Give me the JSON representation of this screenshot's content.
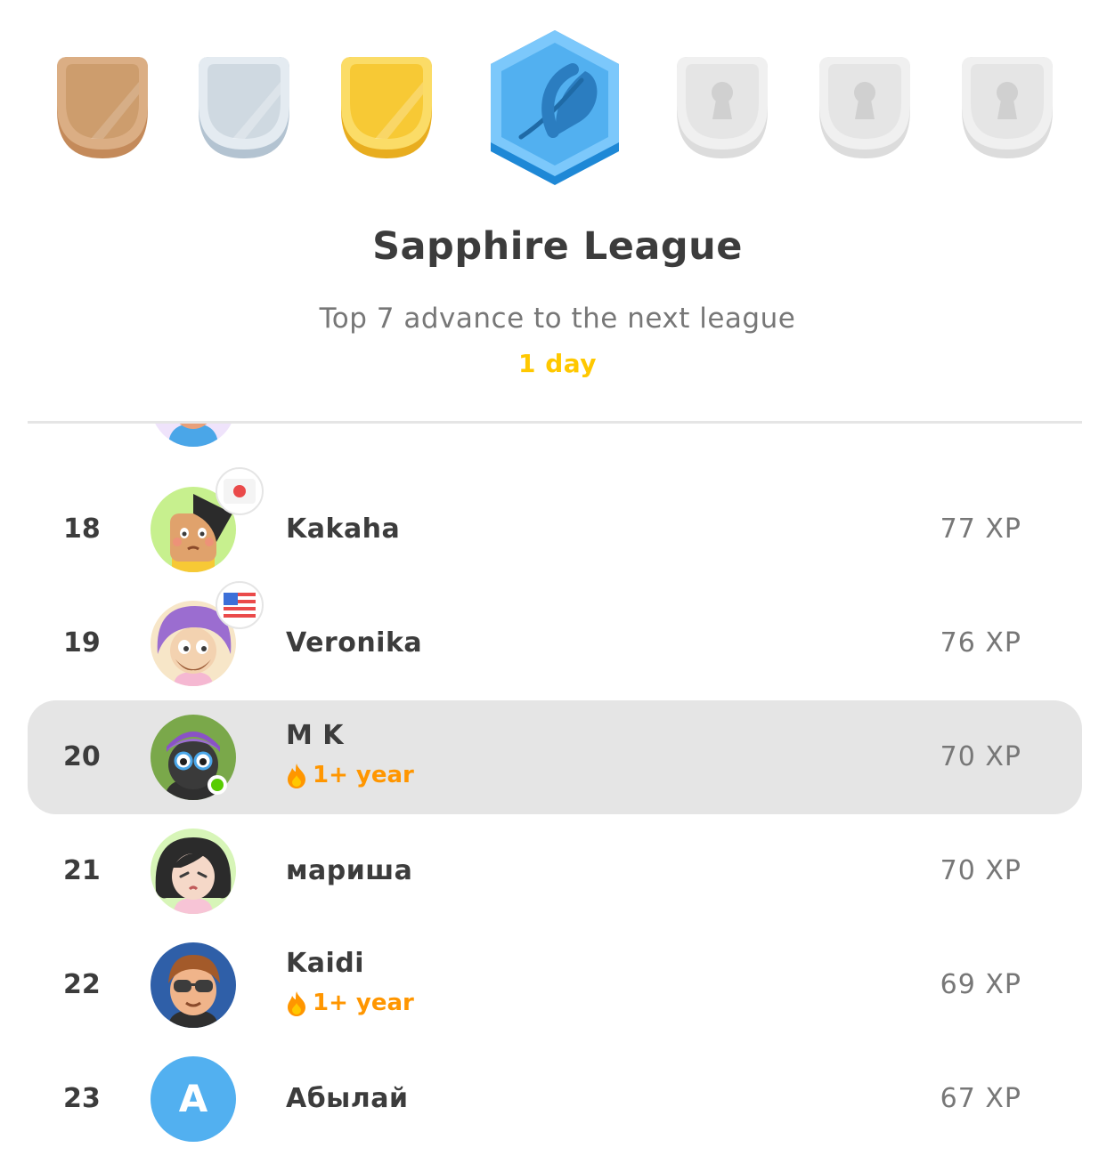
{
  "leagues": [
    {
      "icon": "bronze-shield-icon",
      "color": "#cd9d6d",
      "state": "completed"
    },
    {
      "icon": "silver-shield-icon",
      "color": "#cfd9e1",
      "state": "completed"
    },
    {
      "icon": "gold-shield-icon",
      "color": "#f7c935",
      "state": "completed"
    },
    {
      "icon": "sapphire-feather-icon",
      "color": "#52b0f0",
      "state": "current"
    },
    {
      "icon": "locked-shield-icon",
      "color": "#e5e5e5",
      "state": "locked"
    },
    {
      "icon": "locked-shield-icon",
      "color": "#e5e5e5",
      "state": "locked"
    },
    {
      "icon": "locked-shield-icon",
      "color": "#e5e5e5",
      "state": "locked"
    }
  ],
  "header": {
    "title": "Sapphire League",
    "subtitle": "Top 7 advance to the next league",
    "countdown": "1 day"
  },
  "leaderboard": {
    "rows": [
      {
        "rank": "18",
        "name": "Kakaha",
        "xp": "77 XP",
        "streak": "",
        "flag": "japan-flag-icon",
        "avatar": "avatar-bald-icon"
      },
      {
        "rank": "19",
        "name": "Veronika",
        "xp": "76 XP",
        "streak": "",
        "flag": "usa-flag-icon",
        "avatar": "avatar-purple-hair-icon"
      },
      {
        "rank": "20",
        "name": "M K",
        "xp": "70 XP",
        "streak": "1+ year",
        "online": true,
        "current_user": true,
        "avatar": "avatar-glasses-icon"
      },
      {
        "rank": "21",
        "name": "мариша",
        "xp": "70 XP",
        "streak": "",
        "avatar": "avatar-black-hair-icon"
      },
      {
        "rank": "22",
        "name": "Kaidi",
        "xp": "69 XP",
        "streak": "1+ year",
        "avatar": "avatar-sunglasses-icon"
      },
      {
        "rank": "23",
        "name": "Абылай",
        "xp": "67 XP",
        "streak": "",
        "avatar_letter": "A"
      }
    ]
  },
  "colors": {
    "accent": "#ffc800",
    "streak": "#ff9600",
    "online": "#58cc02",
    "sapphire": "#52b0f0",
    "highlight": "#e5e5e5"
  }
}
